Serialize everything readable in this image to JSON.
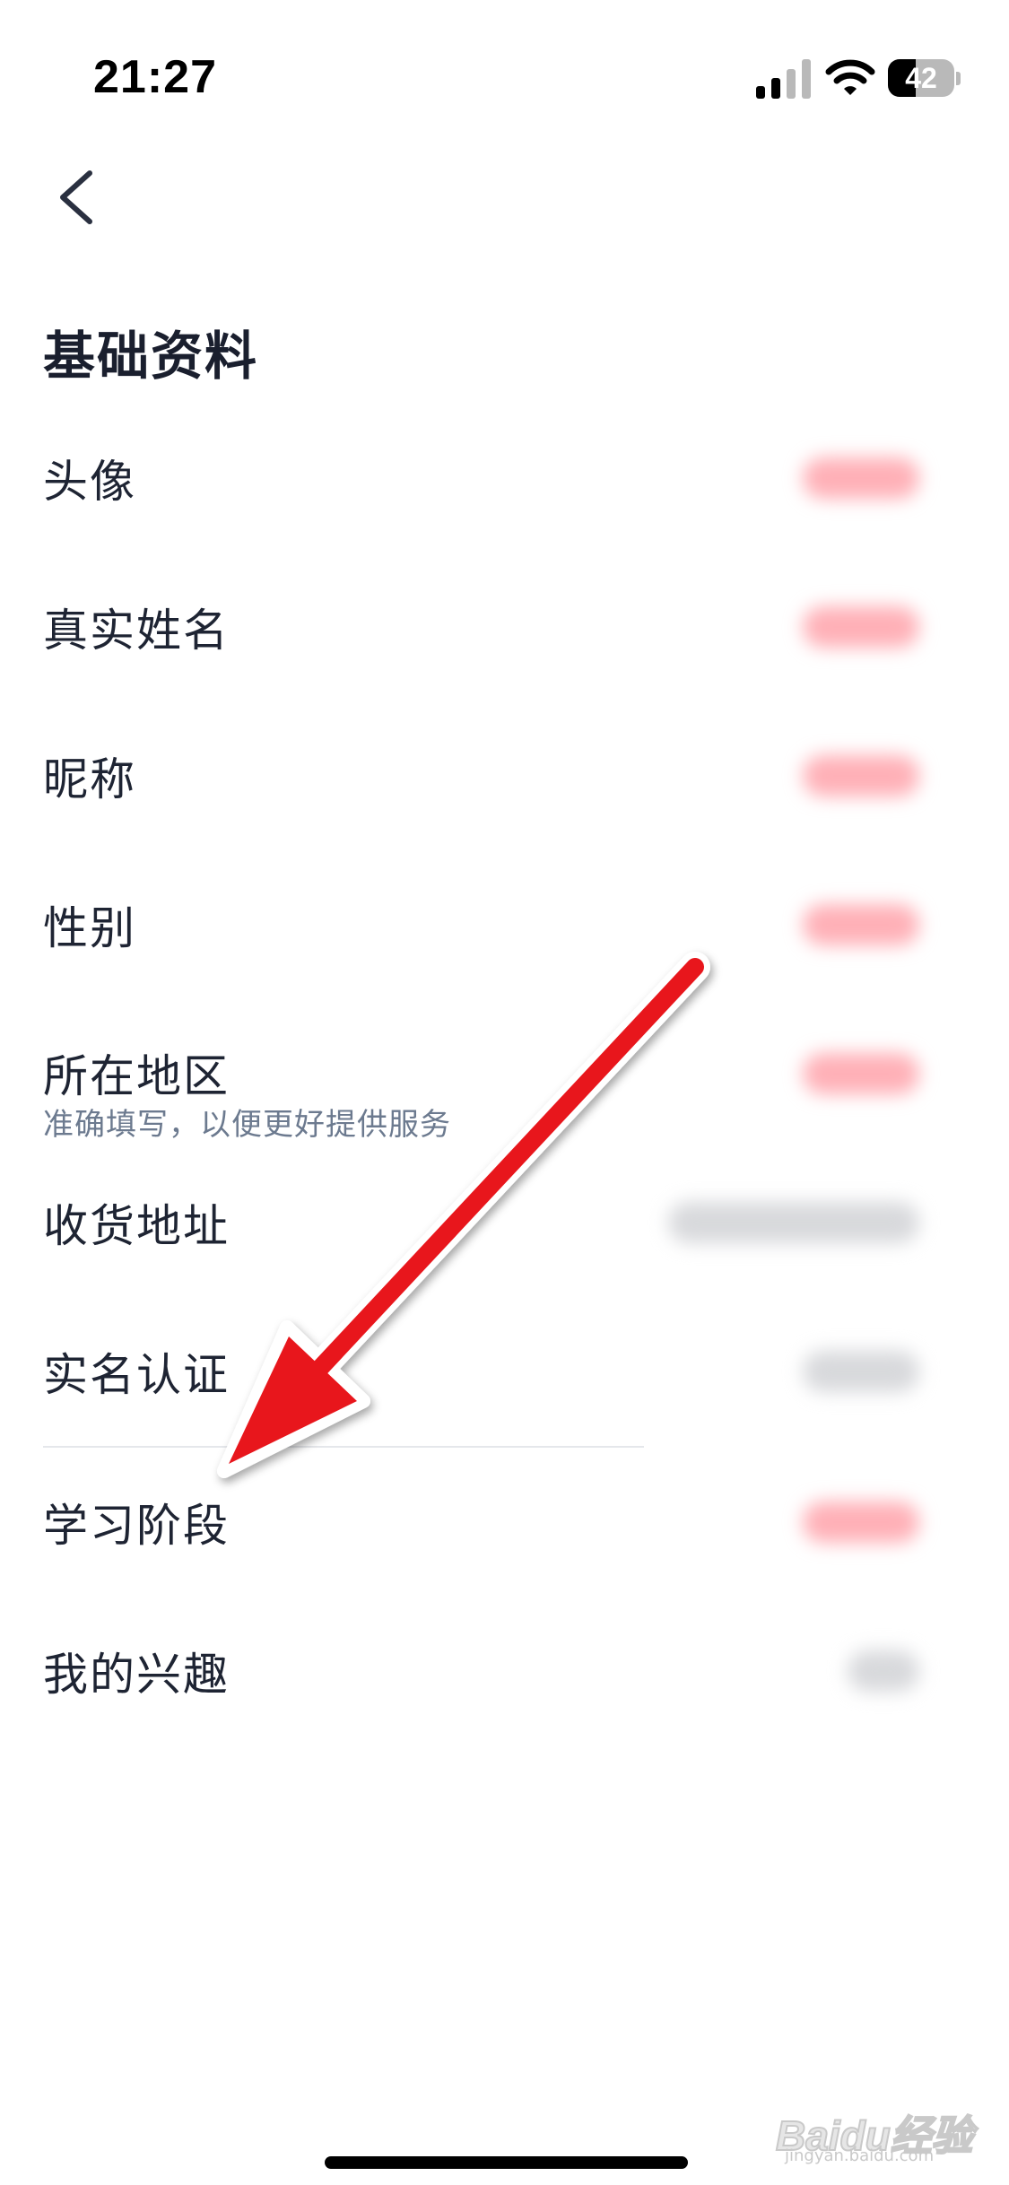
{
  "status_bar": {
    "time": "21:27",
    "battery_level": "42",
    "battery_fraction": 0.42
  },
  "header": {
    "back_icon": "chevron-left-icon"
  },
  "page": {
    "title": "基础资料"
  },
  "rows": [
    {
      "key": "avatar",
      "label": "头像",
      "value_style": "redacted-red"
    },
    {
      "key": "real-name",
      "label": "真实姓名",
      "value_style": "redacted-red"
    },
    {
      "key": "nickname",
      "label": "昵称",
      "value_style": "redacted-red"
    },
    {
      "key": "gender",
      "label": "性别",
      "value_style": "redacted-red"
    },
    {
      "key": "region",
      "label": "所在地区",
      "hint": "准确填写，以便更好提供服务",
      "value_style": "redacted-red"
    },
    {
      "key": "shipping-address",
      "label": "收货地址",
      "value_style": "redacted-gray"
    },
    {
      "key": "real-name-verification",
      "label": "实名认证",
      "value_style": "redacted-gray"
    },
    {
      "key": "study-stage",
      "label": "学习阶段",
      "value_style": "redacted-red"
    },
    {
      "key": "interests",
      "label": "我的兴趣",
      "value_style": "redacted-gray"
    }
  ],
  "annotation": {
    "type": "arrow",
    "color": "#e8141b",
    "points_to": "学习阶段"
  },
  "watermark": {
    "brand": "Baidu经验",
    "sub": "jingyan.baidu.com"
  },
  "colors": {
    "text_primary": "#1e2433",
    "text_hint": "#6c7a8f",
    "redacted_red": "#ffb0b7",
    "redacted_gray": "#d8d9dc"
  }
}
